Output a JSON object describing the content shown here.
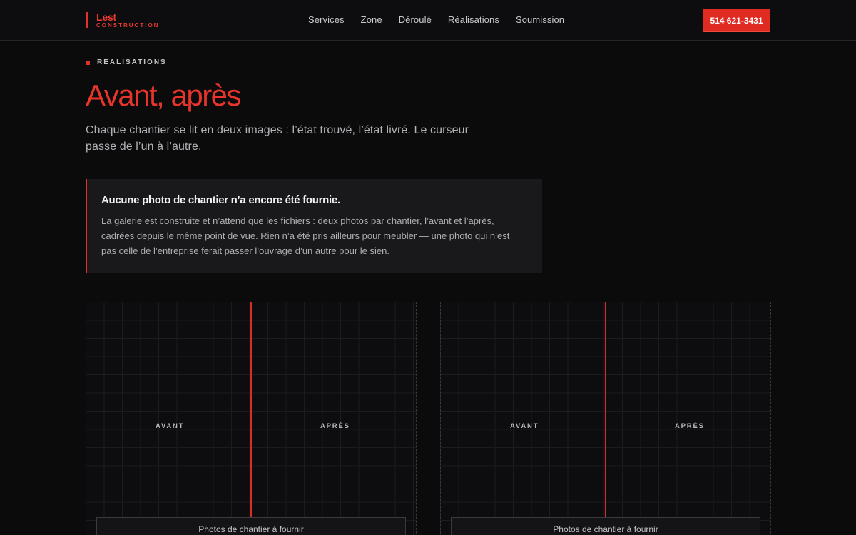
{
  "header": {
    "logo_name": "Lest",
    "logo_sub": "CONSTRUCTION",
    "nav": [
      "Services",
      "Zone",
      "Déroulé",
      "Réalisations",
      "Soumission"
    ],
    "phone": "514 621-3431"
  },
  "section": {
    "eyebrow": "RÉALISATIONS",
    "title": "Avant, après",
    "lede": "Chaque chantier se lit en deux images : l’état trouvé, l’état livré. Le curseur passe de l’un à l’autre."
  },
  "notice": {
    "title": "Aucune photo de chantier n’a encore été fournie.",
    "body": "La galerie est construite et n’attend que les fichiers : deux photos par chantier, l’avant et l’après, cadrées depuis le même point de vue. Rien n’a été pris ailleurs pour meubler — une photo qui n’est pas celle de l’entreprise ferait passer l’ouvrage d’un autre pour le sien."
  },
  "gallery": [
    {
      "before": "AVANT",
      "after": "APRÈS",
      "caption": "Photos de chantier à fournir"
    },
    {
      "before": "AVANT",
      "after": "APRÈS",
      "caption": "Photos de chantier à fournir"
    }
  ],
  "colors": {
    "accent": "#e0322a",
    "background": "#0b0b0c"
  }
}
